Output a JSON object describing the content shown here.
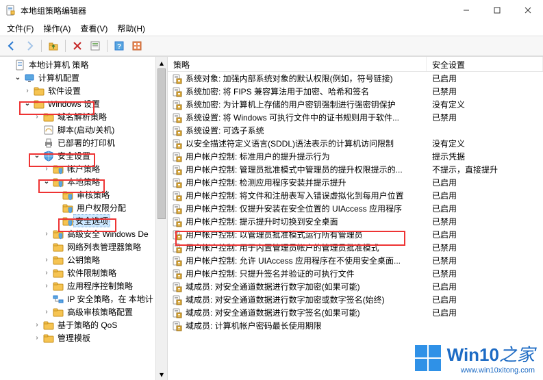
{
  "window": {
    "title": "本地组策略编辑器"
  },
  "menu": {
    "file": "文件(F)",
    "action": "操作(A)",
    "view": "查看(V)",
    "help": "帮助(H)"
  },
  "tree": {
    "root": "本地计算机 策略",
    "computer_config": "计算机配置",
    "software_settings": "软件设置",
    "windows_settings": "Windows 设置",
    "name_resolution": "域名解析策略",
    "scripts": "脚本(启动/关机)",
    "deployed_printers": "已部署的打印机",
    "security_settings": "安全设置",
    "account_policies": "帐户策略",
    "local_policies": "本地策略",
    "audit_policy": "审核策略",
    "user_rights": "用户权限分配",
    "security_options": "安全选项",
    "adv_windows_defender": "高级安全 Windows De",
    "network_list": "网络列表管理器策略",
    "public_key": "公钥策略",
    "software_restriction": "软件限制策略",
    "app_control": "应用程序控制策略",
    "ip_security": "IP 安全策略，在 本地计",
    "adv_audit": "高级审核策略配置",
    "policy_qos": "基于策略的 QoS",
    "admin_templates": "管理模板"
  },
  "list_header": {
    "policy": "策略",
    "setting": "安全设置"
  },
  "policies": [
    {
      "name": "系统对象: 加强内部系统对象的默认权限(例如，符号链接)",
      "setting": "已启用"
    },
    {
      "name": "系统加密: 将 FIPS 兼容算法用于加密、哈希和签名",
      "setting": "已禁用"
    },
    {
      "name": "系统加密: 为计算机上存储的用户密钥强制进行强密钥保护",
      "setting": "没有定义"
    },
    {
      "name": "系统设置: 将 Windows 可执行文件中的证书规则用于软件...",
      "setting": "已禁用"
    },
    {
      "name": "系统设置: 可选子系统",
      "setting": ""
    },
    {
      "name": "以安全描述符定义语言(SDDL)语法表示的计算机访问限制",
      "setting": "没有定义"
    },
    {
      "name": "用户帐户控制: 标准用户的提升提示行为",
      "setting": "提示凭据"
    },
    {
      "name": "用户帐户控制: 管理员批准模式中管理员的提升权限提示的...",
      "setting": "不提示，直接提升"
    },
    {
      "name": "用户帐户控制: 检测应用程序安装并提示提升",
      "setting": "已启用"
    },
    {
      "name": "用户帐户控制: 将文件和注册表写入错误虚拟化到每用户位置",
      "setting": "已启用"
    },
    {
      "name": "用户帐户控制: 仅提升安装在安全位置的 UIAccess 应用程序",
      "setting": "已启用"
    },
    {
      "name": "用户帐户控制: 提示提升时切换到安全桌面",
      "setting": "已禁用"
    },
    {
      "name": "用户帐户控制: 以管理员批准模式运行所有管理员",
      "setting": "已启用"
    },
    {
      "name": "用户帐户控制: 用于内置管理员帐户的管理员批准模式",
      "setting": "已禁用"
    },
    {
      "name": "用户帐户控制: 允许 UIAccess 应用程序在不使用安全桌面...",
      "setting": "已禁用"
    },
    {
      "name": "用户帐户控制: 只提升签名并验证的可执行文件",
      "setting": "已禁用"
    },
    {
      "name": "域成员: 对安全通道数据进行数字加密(如果可能)",
      "setting": "已启用"
    },
    {
      "name": "域成员: 对安全通道数据进行数字加密或数字签名(始终)",
      "setting": "已启用"
    },
    {
      "name": "域成员: 对安全通道数据进行数字签名(如果可能)",
      "setting": "已启用"
    },
    {
      "name": "域成员: 计算机帐户密码最长使用期限",
      "setting": ""
    }
  ],
  "watermark": {
    "brand1": "Win10",
    "brand2": "之家",
    "url": "www.win10xitong.com"
  }
}
